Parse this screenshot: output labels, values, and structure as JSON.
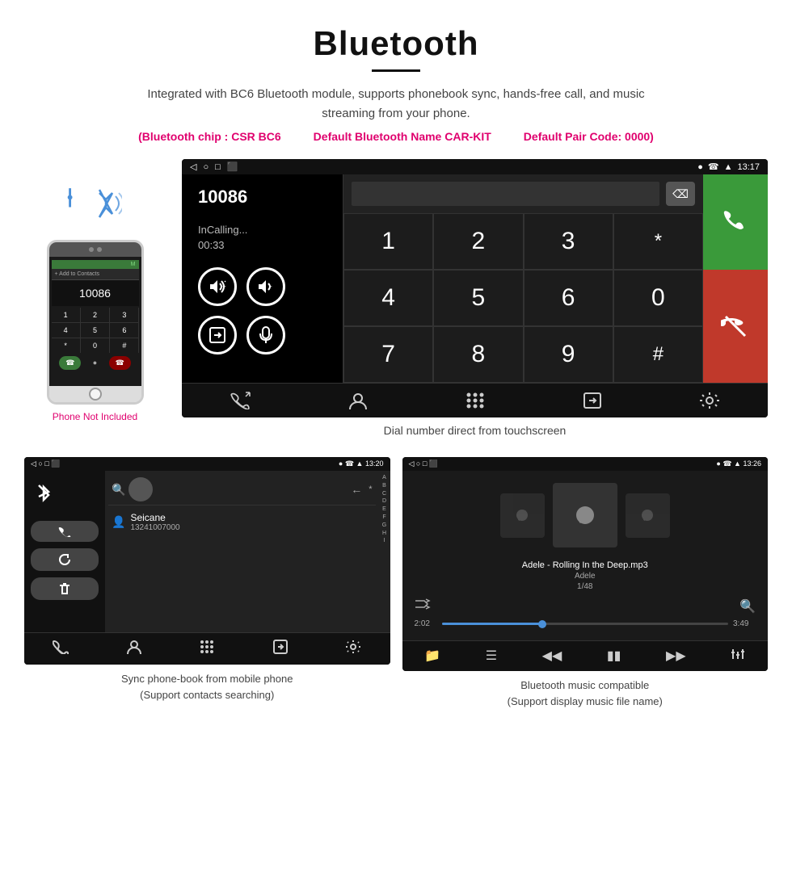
{
  "header": {
    "title": "Bluetooth",
    "description": "Integrated with BC6 Bluetooth module, supports phonebook sync, hands-free call, and music streaming from your phone.",
    "spec1": "(Bluetooth chip : CSR BC6",
    "spec2": "Default Bluetooth Name CAR-KIT",
    "spec3": "Default Pair Code: 0000)"
  },
  "phone": {
    "not_included": "Phone Not Included",
    "add_contacts": "+ Add to Contacts",
    "keys": [
      "1",
      "2",
      "3",
      "4",
      "5",
      "6",
      "*",
      "0",
      "#"
    ]
  },
  "car_screen": {
    "status_bar": {
      "nav": "◁  ○  □  ⬛",
      "icons": "♥  ☎  ▲  13:17"
    },
    "call": {
      "number": "10086",
      "status": "InCalling...",
      "timer": "00:33"
    },
    "dialpad": {
      "keys": [
        "1",
        "2",
        "3",
        "*",
        "4",
        "5",
        "6",
        "0",
        "7",
        "8",
        "9",
        "#"
      ]
    },
    "caption": "Dial number direct from touchscreen"
  },
  "phonebook_screen": {
    "status_time": "13:20",
    "contact_name": "Seicane",
    "contact_number": "13241007000",
    "alphabet": [
      "A",
      "B",
      "C",
      "D",
      "E",
      "F",
      "G",
      "H",
      "I"
    ],
    "caption_line1": "Sync phone-book from mobile phone",
    "caption_line2": "(Support contacts searching)"
  },
  "music_screen": {
    "status_time": "13:26",
    "song_title": "Adele - Rolling In the Deep.mp3",
    "artist": "Adele",
    "track": "1/48",
    "time_current": "2:02",
    "time_total": "3:49",
    "caption_line1": "Bluetooth music compatible",
    "caption_line2": "(Support display music file name)"
  }
}
